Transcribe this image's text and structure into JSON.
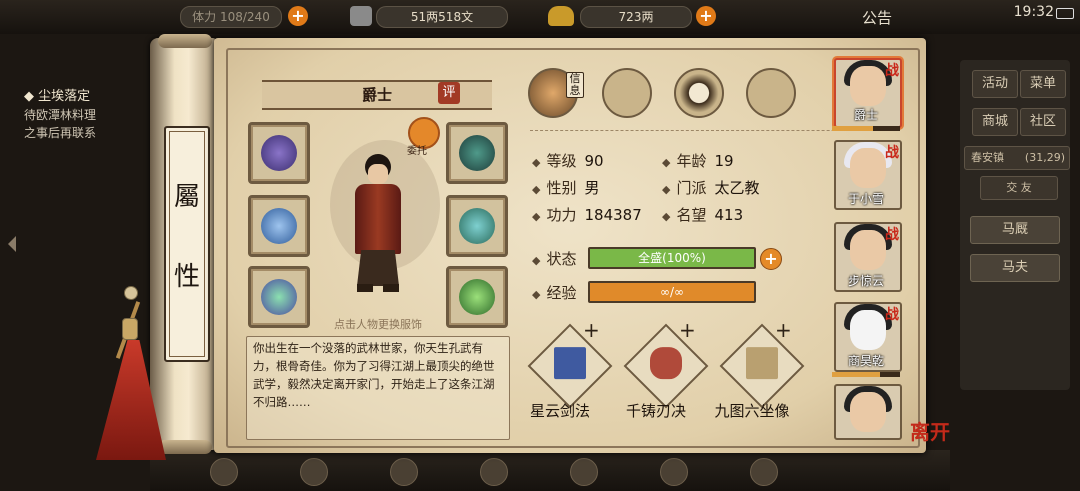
{
  "topbar": {
    "left_cut": "体力 108/240",
    "copper": "51两518文",
    "gold": "723两",
    "announce": "公告",
    "time": "19:32"
  },
  "quest": {
    "title": "◆ 尘埃落定",
    "line1": "待欧潭林料理",
    "line2": "之事后再联系"
  },
  "right_menu": {
    "row1": [
      "活动",
      "菜单"
    ],
    "row2": [
      "商城",
      "社区"
    ],
    "location": "春安镇",
    "coords": "(31,29)",
    "tab": "交   友",
    "npcs": [
      "马厩",
      "马夫"
    ]
  },
  "roller": {
    "char1": "屬",
    "char2": "性"
  },
  "character": {
    "name": "爵士",
    "ping_label": "评",
    "weituo": "委托",
    "outfit_hint": "点击人物更换服饰",
    "description": "你出生在一个没落的武林世家，你天生孔武有力，根骨奇佳。你为了习得江湖上最顶尖的绝世武学，毅然决定离开家门，开始走上了这条江湖不归路……"
  },
  "info_icon_label": "信息",
  "stats": {
    "level_label": "等级",
    "level": "90",
    "age_label": "年龄",
    "age": "19",
    "gender_label": "性别",
    "gender": "男",
    "sect_label": "门派",
    "sect": "太乙教",
    "power_label": "功力",
    "power": "184387",
    "fame_label": "名望",
    "fame": "413",
    "state_label": "状态",
    "state": "全盛(100%)",
    "state_pct": 100,
    "exp_label": "经验",
    "exp": "∞/∞"
  },
  "skills": [
    {
      "name": "星云剑法",
      "plus": "+"
    },
    {
      "name": "千铸刃决",
      "plus": "+"
    },
    {
      "name": "九图六坐像",
      "plus": "+"
    }
  ],
  "roster": [
    {
      "name": "爵士",
      "tag": "战",
      "selected": true
    },
    {
      "name": "于小雪",
      "tag": "战"
    },
    {
      "name": "步惊云",
      "tag": "战"
    },
    {
      "name": "商昊乾",
      "tag": "战"
    },
    {
      "name": "",
      "tag": ""
    }
  ],
  "leave_label": "离开",
  "colors": {
    "state_bar": "#7ab848",
    "exp_bar": "#e08a2a",
    "accent": "#c32a1a"
  }
}
